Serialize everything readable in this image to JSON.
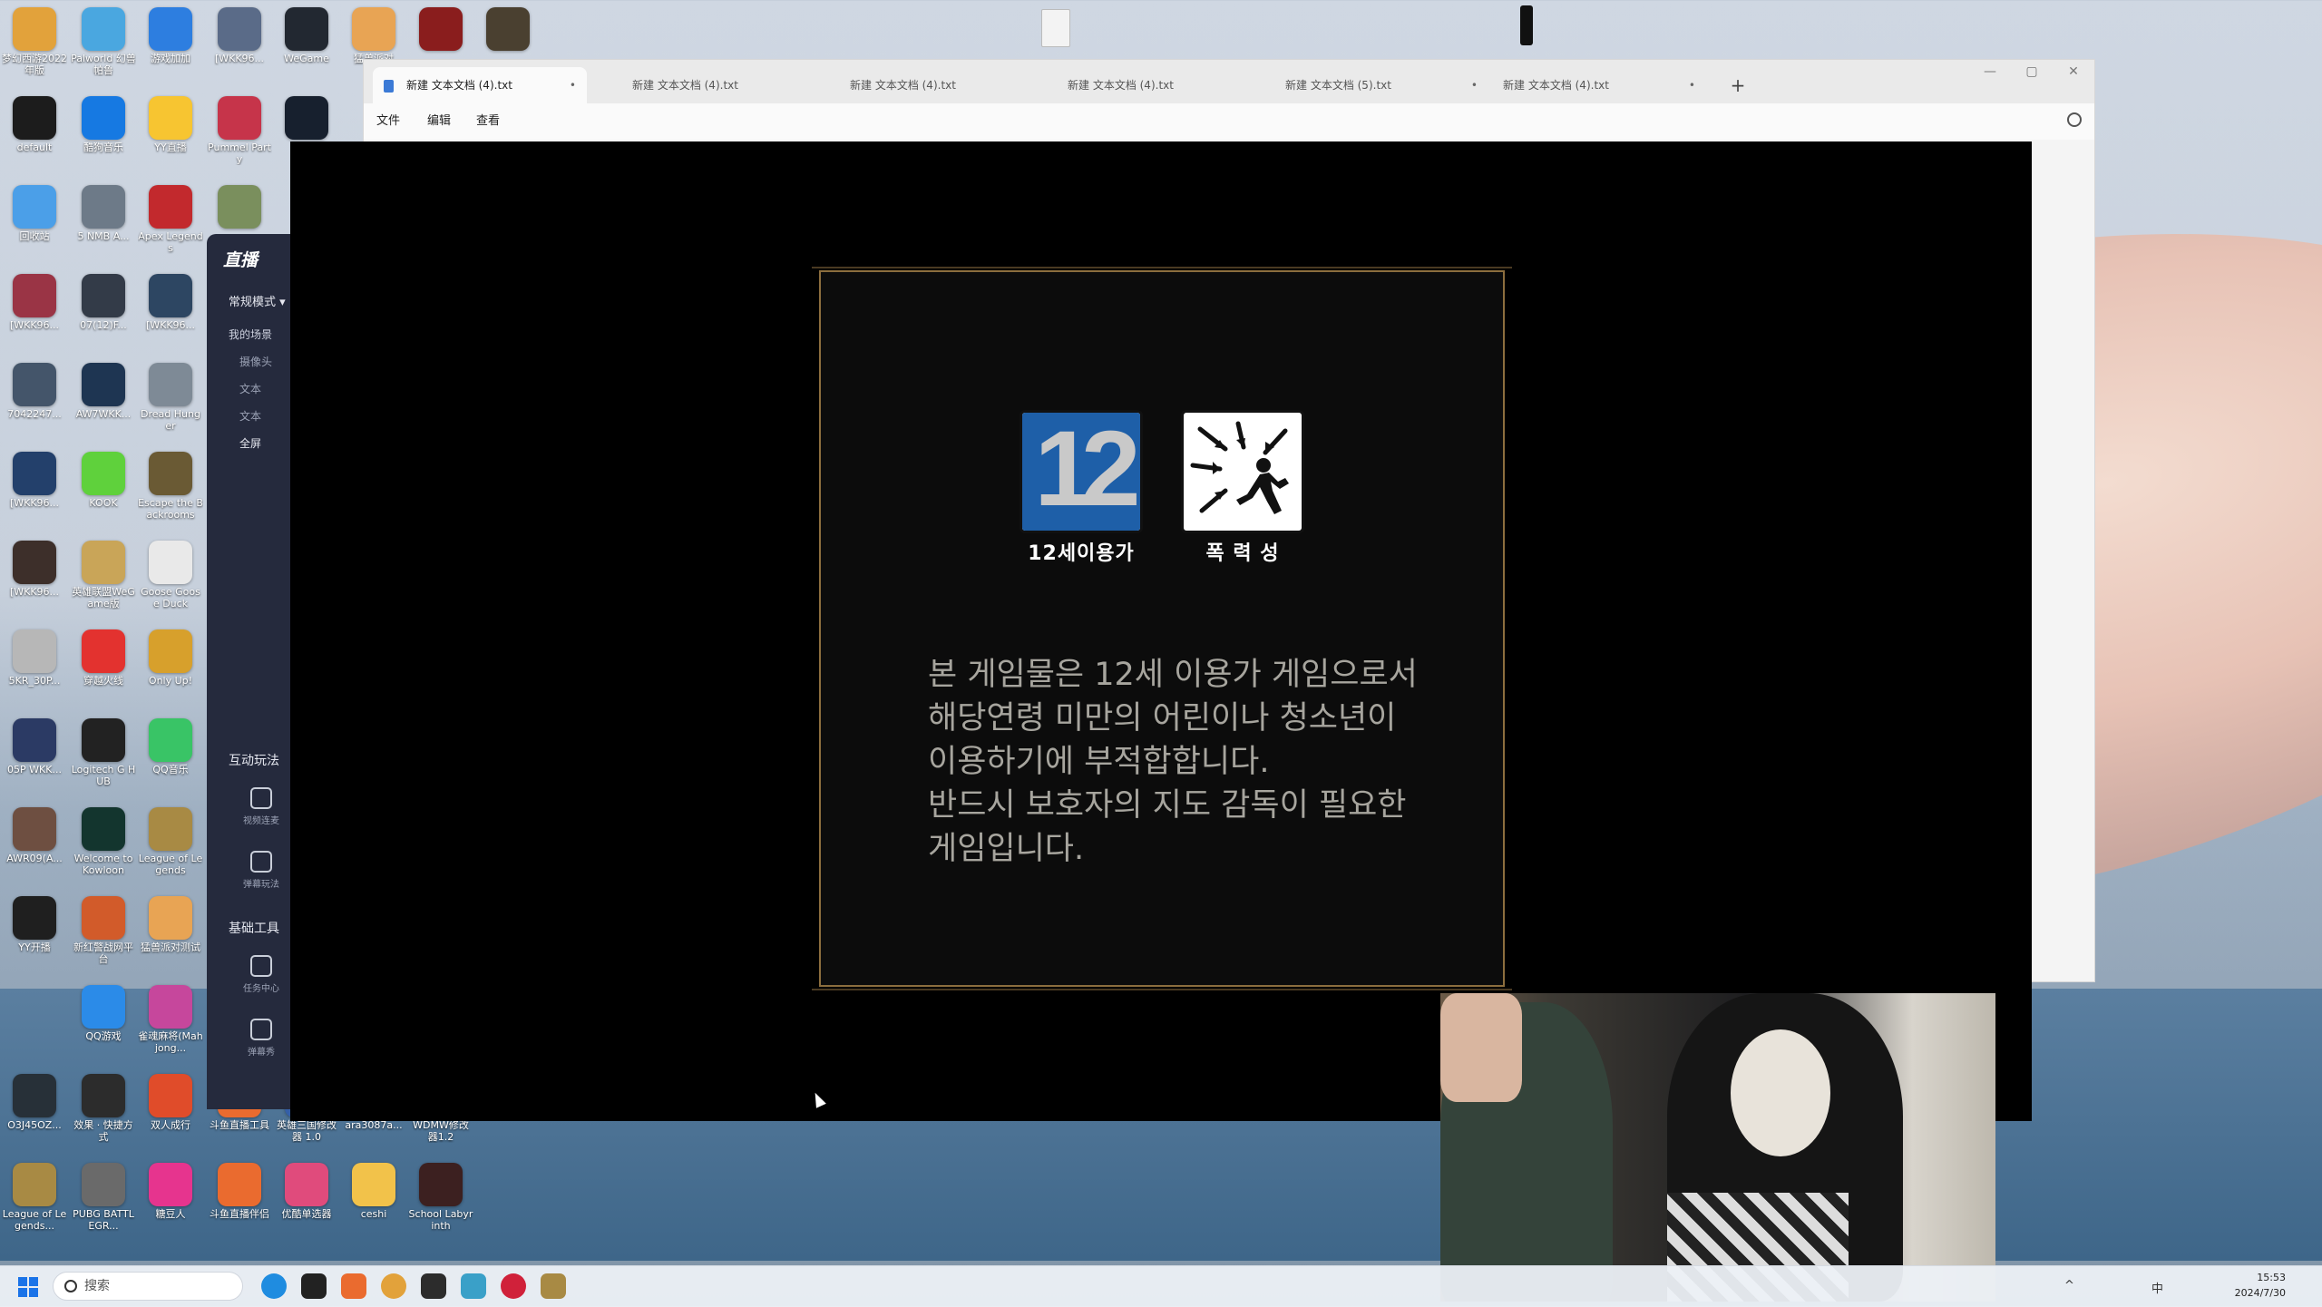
{
  "desktop": {
    "icons": [
      {
        "label": "梦幻西游2022年版",
        "color": "#e2a23b"
      },
      {
        "label": "Palworld 幻兽帕鲁",
        "color": "#4aa7e0"
      },
      {
        "label": "游戏加加",
        "color": "#2d7ee0"
      },
      {
        "label": "[WKK96...",
        "color": "#5a6b88"
      },
      {
        "label": "WeGame",
        "color": "#222831"
      },
      {
        "label": "猛兽派对",
        "color": "#e8a454"
      },
      {
        "label": "",
        "color": "#8a1d1d"
      },
      {
        "label": "",
        "color": "#4a4030"
      },
      {
        "label": "default",
        "color": "#1c1c1c"
      },
      {
        "label": "酷狗音乐",
        "color": "#1679e2"
      },
      {
        "label": "YY直播",
        "color": "#f7c531"
      },
      {
        "label": "Pummel Party",
        "color": "#c6344a"
      },
      {
        "label": "",
        "color": "#17202e"
      },
      {
        "label": "回收站",
        "color": "#4b9fe8"
      },
      {
        "label": "5 NMB A...",
        "color": "#6d7a88"
      },
      {
        "label": "Apex Legends",
        "color": "#c2292d"
      },
      {
        "label": "",
        "color": "#7a8f5d"
      },
      {
        "label": "[WKK96...",
        "color": "#9a3445"
      },
      {
        "label": "07(12)F...",
        "color": "#333b48"
      },
      {
        "label": "[WKK96...",
        "color": "#2d4662"
      },
      {
        "label": "7042247...",
        "color": "#44556a"
      },
      {
        "label": "AW7WKK...",
        "color": "#1e3552"
      },
      {
        "label": "Dread Hunger",
        "color": "#7e8a96"
      },
      {
        "label": "[WKK96...",
        "color": "#23406b"
      },
      {
        "label": "KOOK",
        "color": "#5fd13c"
      },
      {
        "label": "Escape the Backrooms",
        "color": "#6a5a34"
      },
      {
        "label": "[WKK96...",
        "color": "#3d2f2a"
      },
      {
        "label": "英雄联盟WeGame版",
        "color": "#c9a558"
      },
      {
        "label": "Goose Goose Duck",
        "color": "#e9e9e9"
      },
      {
        "label": "5KR_30P...",
        "color": "#b7b7b7"
      },
      {
        "label": "穿越火线",
        "color": "#e3322f"
      },
      {
        "label": "Only Up!",
        "color": "#d7a02c"
      },
      {
        "label": "05P WKK...",
        "color": "#2b3a64"
      },
      {
        "label": "Logitech G HUB",
        "color": "#222"
      },
      {
        "label": "QQ音乐",
        "color": "#39c466"
      },
      {
        "label": "AWR09(A...",
        "color": "#6e4f41"
      },
      {
        "label": "Welcome to Kowloon",
        "color": "#13352e"
      },
      {
        "label": "League of Legends",
        "color": "#a88a44"
      },
      {
        "label": "YY开播",
        "color": "#1f1f1f"
      },
      {
        "label": "新红警战网平台",
        "color": "#d25b2a"
      },
      {
        "label": "猛兽派对测试",
        "color": "#e8a454"
      },
      {
        "label": "QQ游戏",
        "color": "#2b8be8"
      },
      {
        "label": "雀魂麻将(Mahjong...",
        "color": "#c6479c"
      },
      {
        "label": "O3J45OZ...",
        "color": "#273038"
      },
      {
        "label": "效果 · 快捷方式",
        "color": "#2c2c2c"
      },
      {
        "label": "双人成行",
        "color": "#e04c2a"
      },
      {
        "label": "斗鱼直播工具",
        "color": "#ea6b2f"
      },
      {
        "label": "英雄三国修改器 1.0",
        "color": "#345fa8"
      },
      {
        "label": "ara3087a...",
        "color": "#3e4c5c"
      },
      {
        "label": "WDMW修改器1.2",
        "color": "#5e6a78"
      },
      {
        "label": "League of Legends...",
        "color": "#a88a44"
      },
      {
        "label": "PUBG BATTLEGR...",
        "color": "#6a6a6a"
      },
      {
        "label": "糖豆人",
        "color": "#e6348e"
      },
      {
        "label": "斗鱼直播伴侣",
        "color": "#ea6b2f"
      },
      {
        "label": "优酷单选器",
        "color": "#e04b7c"
      },
      {
        "label": "ceshi",
        "color": "#f2c24a"
      },
      {
        "label": "School Labyrinth",
        "color": "#3c2020"
      }
    ]
  },
  "stream_app": {
    "logo": "直播",
    "mode": "常规模式 ▾",
    "scene_header": "我的场景",
    "scene_items": [
      "摄像头",
      "文本",
      "文本",
      "全屏"
    ],
    "section_interactive": "互动玩法",
    "tools_interactive": [
      "视频连麦",
      "弹幕玩法"
    ],
    "section_basic": "基础工具",
    "tools_basic": [
      "任务中心",
      "弹幕秀"
    ]
  },
  "notepad": {
    "tabs": [
      {
        "label": "新建 文本文档 (4).txt",
        "dirty": "•",
        "active": true
      },
      {
        "label": "新建 文本文档 (4).txt",
        "dirty": "",
        "active": false
      },
      {
        "label": "新建 文本文档 (4).txt",
        "dirty": "",
        "active": false
      },
      {
        "label": "新建 文本文档 (4).txt",
        "dirty": "",
        "active": false
      },
      {
        "label": "新建 文本文档 (5).txt",
        "dirty": "•",
        "active": false
      },
      {
        "label": "新建 文本文档 (4).txt",
        "dirty": "•",
        "active": false
      }
    ],
    "add_tab": "+",
    "menu": [
      "文件",
      "编辑",
      "查看"
    ],
    "window_controls": [
      "—",
      "▢",
      "✕"
    ]
  },
  "game": {
    "badges": [
      {
        "caption": "12세이용가",
        "type": "age-12"
      },
      {
        "caption": "폭 력 성",
        "type": "violence"
      }
    ],
    "age_number_a": "1",
    "age_number_b": "2",
    "notice_lines": [
      "본 게임물은 12세 이용가 게임으로서",
      "해당연령 미만의 어린이나 청소년이",
      "이용하기에 부적합합니다.",
      "반드시 보호자의 지도 감독이 필요한",
      "게임입니다."
    ],
    "border_color": "#8c6e3e",
    "text_color": "#a7a59e"
  },
  "taskbar": {
    "search_placeholder": "搜索",
    "tray": [
      "^",
      "中"
    ],
    "time": "15:53",
    "date": "2024/7/30"
  }
}
